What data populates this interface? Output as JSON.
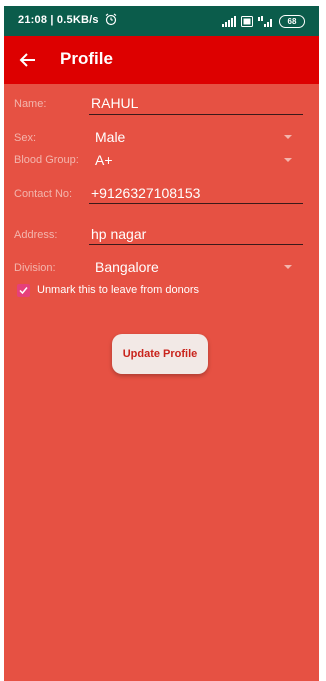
{
  "status_bar": {
    "time_speed": "21:08 | 0.5KB/s",
    "battery": "68"
  },
  "app_bar": {
    "title": "Profile"
  },
  "form": {
    "name_label": "Name:",
    "name_value": "RAHUL",
    "sex_label": "Sex:",
    "sex_value": "Male",
    "blood_group_label": "Blood Group:",
    "blood_group_value": "A+",
    "contact_label": "Contact No:",
    "contact_value": "+9126327108153",
    "address_label": "Address:",
    "address_value": "hp nagar",
    "division_label": "Division:",
    "division_value": "Bangalore",
    "donor_checkbox_label": "Unmark this to leave from donors",
    "donor_checked": true
  },
  "actions": {
    "update_label": "Update Profile"
  },
  "colors": {
    "background": "#e65143",
    "app_bar": "#dd0000",
    "status_bar": "#0b5c4b",
    "checkbox": "#e6407a",
    "button_text": "#c9241c"
  }
}
